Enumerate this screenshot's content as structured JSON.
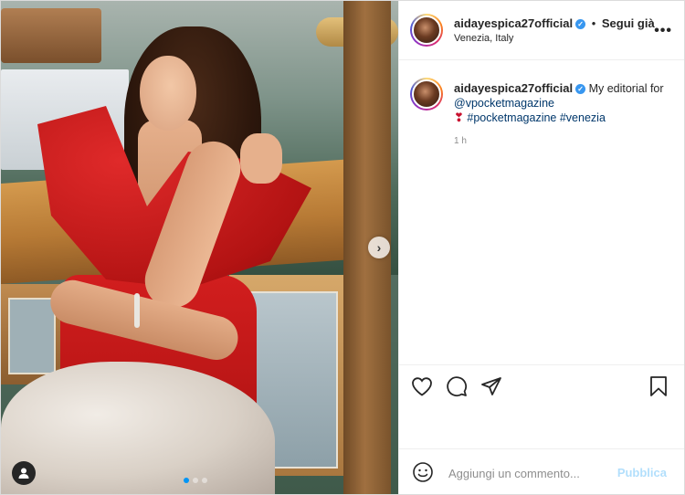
{
  "post": {
    "author": {
      "username": "aidayespica27official",
      "verified_mark": "✓",
      "separator": "•",
      "follow_label": "Segui già",
      "location": "Venezia, Italy"
    },
    "more_icon": "more-horizontal-icon",
    "more_label": "•••",
    "caption": {
      "username": "aidayespica27official",
      "text_before": "My editorial for",
      "mention": "@vpocketmagazine",
      "heart": "❣",
      "hashtag1": "#pocketmagazine",
      "hashtag2": "#venezia"
    },
    "time": "1 h",
    "media": {
      "next_label": "›",
      "carousel_count": 3,
      "carousel_active": 1
    },
    "actions": {
      "like_icon": "heart-icon",
      "comment_icon": "comment-icon",
      "share_icon": "send-icon",
      "save_icon": "bookmark-icon"
    },
    "comment_box": {
      "placeholder": "Aggiungi un commento...",
      "publish_label": "Pubblica"
    },
    "colors": {
      "link": "#00376b",
      "verified": "#3897f0",
      "publish_disabled": "#b2dffc",
      "carousel_active": "#0095f6"
    }
  }
}
